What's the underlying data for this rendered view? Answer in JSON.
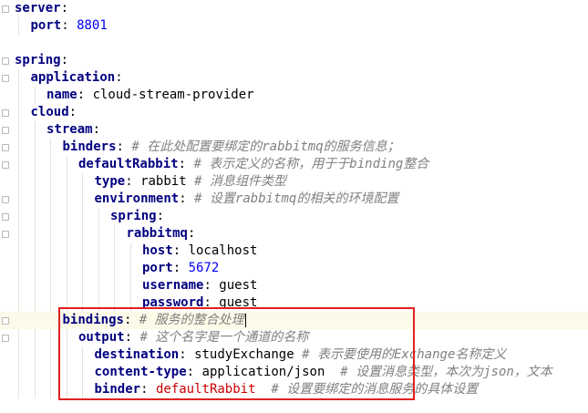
{
  "editor": {
    "lines": [
      {
        "indent": 0,
        "segments": [
          {
            "t": "key",
            "v": "server"
          },
          {
            "t": "punct",
            "v": ":"
          }
        ]
      },
      {
        "indent": 1,
        "segments": [
          {
            "t": "key",
            "v": "port"
          },
          {
            "t": "punct",
            "v": ": "
          },
          {
            "t": "num",
            "v": "8801"
          }
        ]
      },
      {
        "indent": 0,
        "segments": []
      },
      {
        "indent": 0,
        "segments": [
          {
            "t": "key",
            "v": "spring"
          },
          {
            "t": "punct",
            "v": ":"
          }
        ]
      },
      {
        "indent": 1,
        "segments": [
          {
            "t": "key",
            "v": "application"
          },
          {
            "t": "punct",
            "v": ":"
          }
        ]
      },
      {
        "indent": 2,
        "segments": [
          {
            "t": "key",
            "v": "name"
          },
          {
            "t": "punct",
            "v": ": "
          },
          {
            "t": "str",
            "v": "cloud-stream-provider"
          }
        ]
      },
      {
        "indent": 1,
        "segments": [
          {
            "t": "key",
            "v": "cloud"
          },
          {
            "t": "punct",
            "v": ":"
          }
        ]
      },
      {
        "indent": 2,
        "segments": [
          {
            "t": "key",
            "v": "stream"
          },
          {
            "t": "punct",
            "v": ":"
          }
        ]
      },
      {
        "indent": 3,
        "segments": [
          {
            "t": "key",
            "v": "binders"
          },
          {
            "t": "punct",
            "v": ": "
          },
          {
            "t": "comment",
            "v": "# 在此处配置要绑定的rabbitmq的服务信息；"
          }
        ]
      },
      {
        "indent": 4,
        "segments": [
          {
            "t": "key",
            "v": "defaultRabbit"
          },
          {
            "t": "punct",
            "v": ": "
          },
          {
            "t": "comment",
            "v": "# 表示定义的名称，用于于binding整合"
          }
        ]
      },
      {
        "indent": 5,
        "segments": [
          {
            "t": "key",
            "v": "type"
          },
          {
            "t": "punct",
            "v": ": "
          },
          {
            "t": "str",
            "v": "rabbit "
          },
          {
            "t": "comment",
            "v": "# 消息组件类型"
          }
        ]
      },
      {
        "indent": 5,
        "segments": [
          {
            "t": "key",
            "v": "environment"
          },
          {
            "t": "punct",
            "v": ": "
          },
          {
            "t": "comment",
            "v": "# 设置rabbitmq的相关的环境配置"
          }
        ]
      },
      {
        "indent": 6,
        "segments": [
          {
            "t": "key",
            "v": "spring"
          },
          {
            "t": "punct",
            "v": ":"
          }
        ]
      },
      {
        "indent": 7,
        "segments": [
          {
            "t": "key",
            "v": "rabbitmq"
          },
          {
            "t": "punct",
            "v": ":"
          }
        ]
      },
      {
        "indent": 8,
        "segments": [
          {
            "t": "key",
            "v": "host"
          },
          {
            "t": "punct",
            "v": ": "
          },
          {
            "t": "str",
            "v": "localhost"
          }
        ]
      },
      {
        "indent": 8,
        "segments": [
          {
            "t": "key",
            "v": "port"
          },
          {
            "t": "punct",
            "v": ": "
          },
          {
            "t": "num",
            "v": "5672"
          }
        ]
      },
      {
        "indent": 8,
        "segments": [
          {
            "t": "key",
            "v": "username"
          },
          {
            "t": "punct",
            "v": ": "
          },
          {
            "t": "str",
            "v": "guest"
          }
        ]
      },
      {
        "indent": 8,
        "segments": [
          {
            "t": "key",
            "v": "password"
          },
          {
            "t": "punct",
            "v": ": "
          },
          {
            "t": "str",
            "v": "guest"
          }
        ]
      },
      {
        "indent": 3,
        "current": true,
        "segments": [
          {
            "t": "key",
            "v": "bindings"
          },
          {
            "t": "punct",
            "v": ": "
          },
          {
            "t": "comment",
            "v": "# 服务的整合处理"
          }
        ],
        "caret": true
      },
      {
        "indent": 4,
        "segments": [
          {
            "t": "key",
            "v": "output"
          },
          {
            "t": "punct",
            "v": ": "
          },
          {
            "t": "comment",
            "v": "# 这个名字是一个通道的名称"
          }
        ]
      },
      {
        "indent": 5,
        "segments": [
          {
            "t": "key",
            "v": "destination"
          },
          {
            "t": "punct",
            "v": ": "
          },
          {
            "t": "str",
            "v": "studyExchange "
          },
          {
            "t": "comment",
            "v": "# 表示要使用的Exchange名称定义"
          }
        ]
      },
      {
        "indent": 5,
        "segments": [
          {
            "t": "key",
            "v": "content-type"
          },
          {
            "t": "punct",
            "v": ": "
          },
          {
            "t": "str",
            "v": "application/json  "
          },
          {
            "t": "comment",
            "v": "# 设置消息类型，本次为json，文本"
          }
        ]
      },
      {
        "indent": 5,
        "segments": [
          {
            "t": "key",
            "v": "binder"
          },
          {
            "t": "punct",
            "v": ": "
          },
          {
            "t": "strred",
            "v": "defaultRabbit  "
          },
          {
            "t": "comment",
            "v": "# 设置要绑定的消息服务的具体设置"
          }
        ]
      }
    ],
    "colors": {
      "key": "#000080",
      "number": "#0000ff",
      "comment": "#808080",
      "highlight_value": "#cc0000",
      "annotation_box": "#e02020",
      "current_line": "#fcfae8"
    }
  }
}
